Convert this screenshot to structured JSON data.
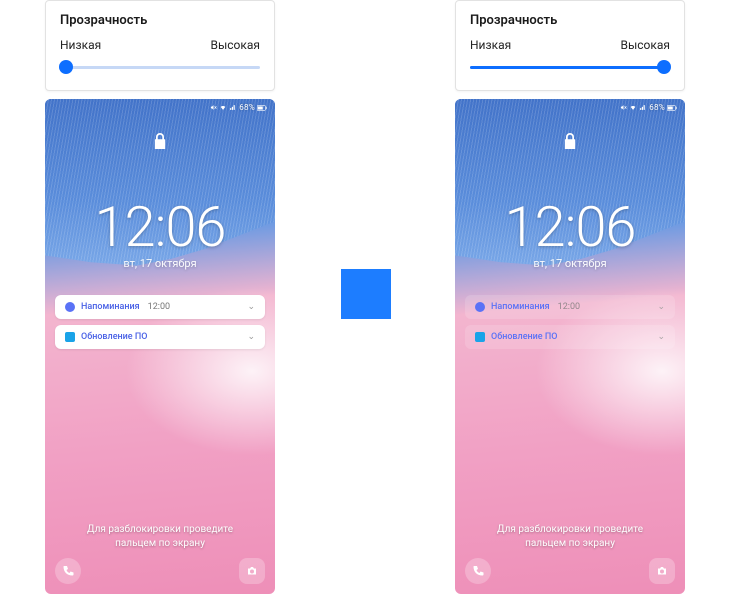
{
  "card": {
    "title": "Прозрачность",
    "low": "Низкая",
    "high": "Высокая"
  },
  "status": {
    "text": "68%",
    "icons": "📶"
  },
  "clock": {
    "time": "12:06",
    "date": "вт, 17 октября"
  },
  "notifications": [
    {
      "app": "Напоминания",
      "detail": "12:00",
      "icon_color": "#5a72f6"
    },
    {
      "app": "Обновление ПО",
      "detail": "",
      "icon_color": "#1aa3e8"
    }
  ],
  "hint": {
    "line1": "Для разблокировки проведите",
    "line2": "пальцем по экрану"
  },
  "slider": {
    "left_pct": 3,
    "right_pct": 97
  }
}
